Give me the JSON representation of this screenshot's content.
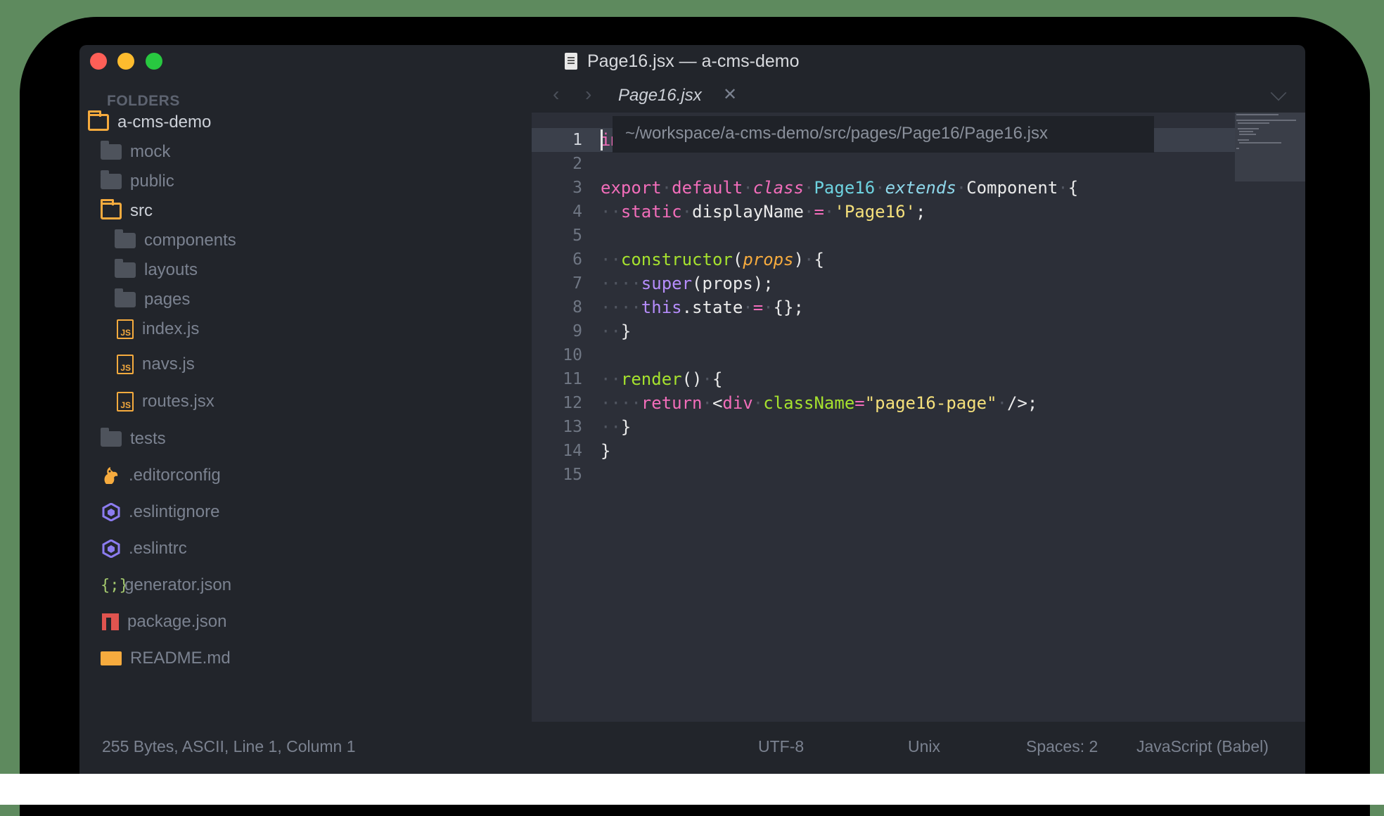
{
  "window": {
    "title": "Page16.jsx — a-cms-demo"
  },
  "sidebar": {
    "header": "FOLDERS",
    "items": [
      {
        "label": "a-cms-demo",
        "icon": "folder-open-icon"
      },
      {
        "label": "mock",
        "icon": "folder-icon"
      },
      {
        "label": "public",
        "icon": "folder-icon"
      },
      {
        "label": "src",
        "icon": "folder-open-icon"
      },
      {
        "label": "components",
        "icon": "folder-icon"
      },
      {
        "label": "layouts",
        "icon": "folder-icon"
      },
      {
        "label": "pages",
        "icon": "folder-icon"
      },
      {
        "label": "index.js",
        "icon": "js-file-icon"
      },
      {
        "label": "navs.js",
        "icon": "js-file-icon"
      },
      {
        "label": "routes.jsx",
        "icon": "js-file-icon"
      },
      {
        "label": "tests",
        "icon": "folder-icon"
      },
      {
        "label": ".editorconfig",
        "icon": "squirrel-icon"
      },
      {
        "label": ".eslintignore",
        "icon": "eslint-icon"
      },
      {
        "label": ".eslintrc",
        "icon": "eslint-icon"
      },
      {
        "label": "generator.json",
        "icon": "json-icon"
      },
      {
        "label": "package.json",
        "icon": "npm-icon"
      },
      {
        "label": "README.md",
        "icon": "markdown-icon"
      }
    ]
  },
  "tab": {
    "label": "Page16.jsx",
    "close": "✕",
    "back": "‹",
    "forward": "›"
  },
  "tooltip": {
    "path": "~/workspace/a-cms-demo/src/pages/Page16/Page16.jsx"
  },
  "editor": {
    "line_numbers": [
      "1",
      "2",
      "3",
      "4",
      "5",
      "6",
      "7",
      "8",
      "9",
      "10",
      "11",
      "12",
      "13",
      "14",
      "15"
    ],
    "line1_visible": "impo"
  },
  "code": {
    "l3": [
      "export",
      "default",
      "class",
      "Page16",
      "extends",
      "Component",
      "{"
    ],
    "l4": [
      "static",
      "displayName",
      "=",
      "'Page16'",
      ";"
    ],
    "l6": [
      "constructor",
      "(",
      "props",
      ")",
      "{"
    ],
    "l7": [
      "super",
      "(props);"
    ],
    "l8": [
      "this",
      ".state",
      "=",
      "{};"
    ],
    "l9": [
      "}"
    ],
    "l11": [
      "render",
      "()",
      "{"
    ],
    "l12": [
      "return",
      "<",
      "div",
      "className",
      "=",
      "\"page16-page\"",
      "/>;"
    ],
    "l13": [
      "}"
    ],
    "l14": [
      "}"
    ]
  },
  "status": {
    "info": "255 Bytes, ASCII, Line 1, Column 1",
    "encoding": "UTF-8",
    "line_endings": "Unix",
    "indent": "Spaces: 2",
    "syntax": "JavaScript (Babel)"
  }
}
